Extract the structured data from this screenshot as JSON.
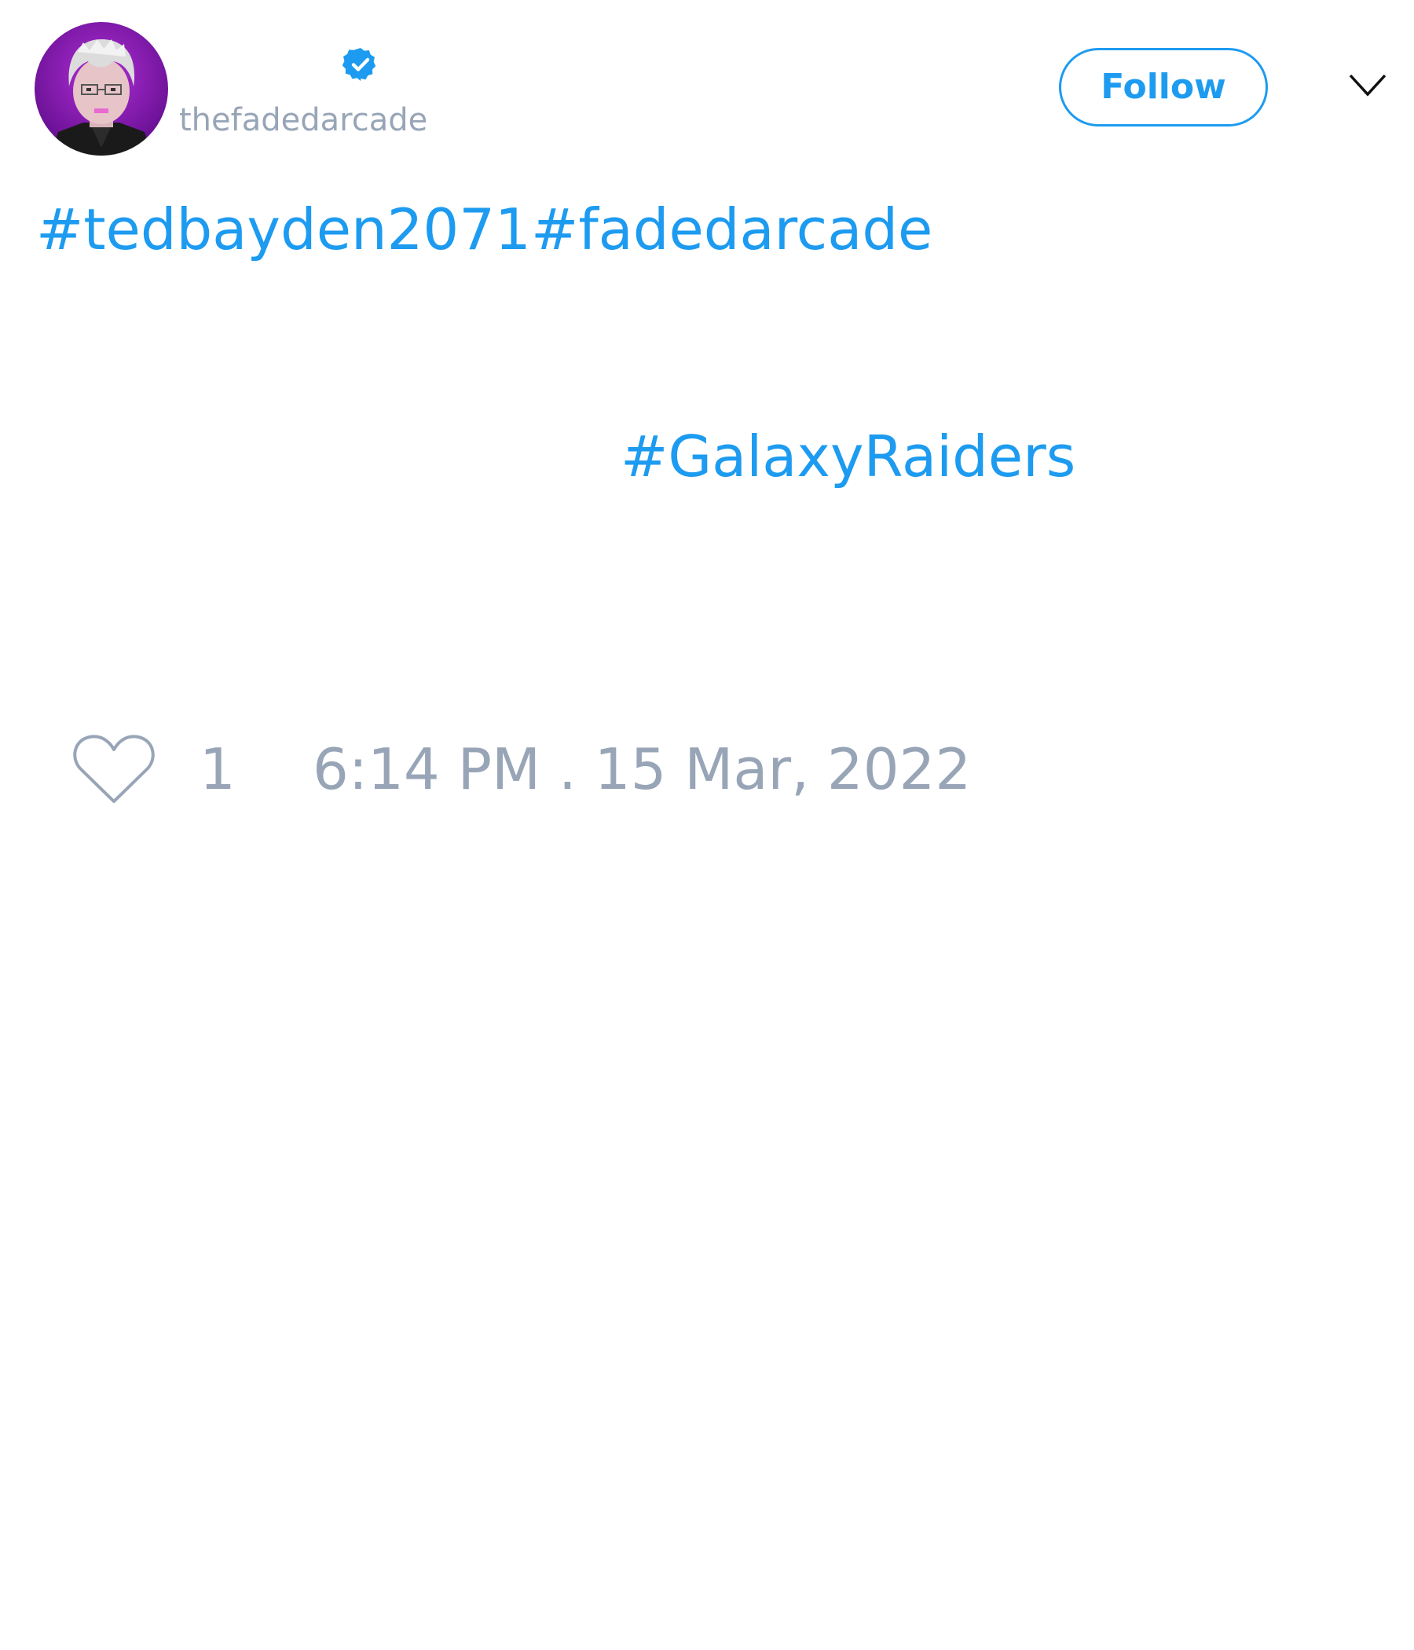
{
  "header": {
    "handle": "thefadedarcade",
    "follow_label": "Follow"
  },
  "icons": {
    "avatar": "user-avatar-image",
    "verified": "verified-badge-icon",
    "menu": "chevron-down-icon",
    "like": "heart-icon"
  },
  "body": {
    "hashtags": [
      "#tedbayden2071",
      "#fadedarcade",
      "#GalaxyRaiders"
    ]
  },
  "footer": {
    "like_count": "1",
    "timestamp": "6:14 PM . 15 Mar, 2022"
  },
  "colors": {
    "link": "#1d9bf0",
    "muted": "#98a5b7",
    "background": "#ffffff"
  }
}
